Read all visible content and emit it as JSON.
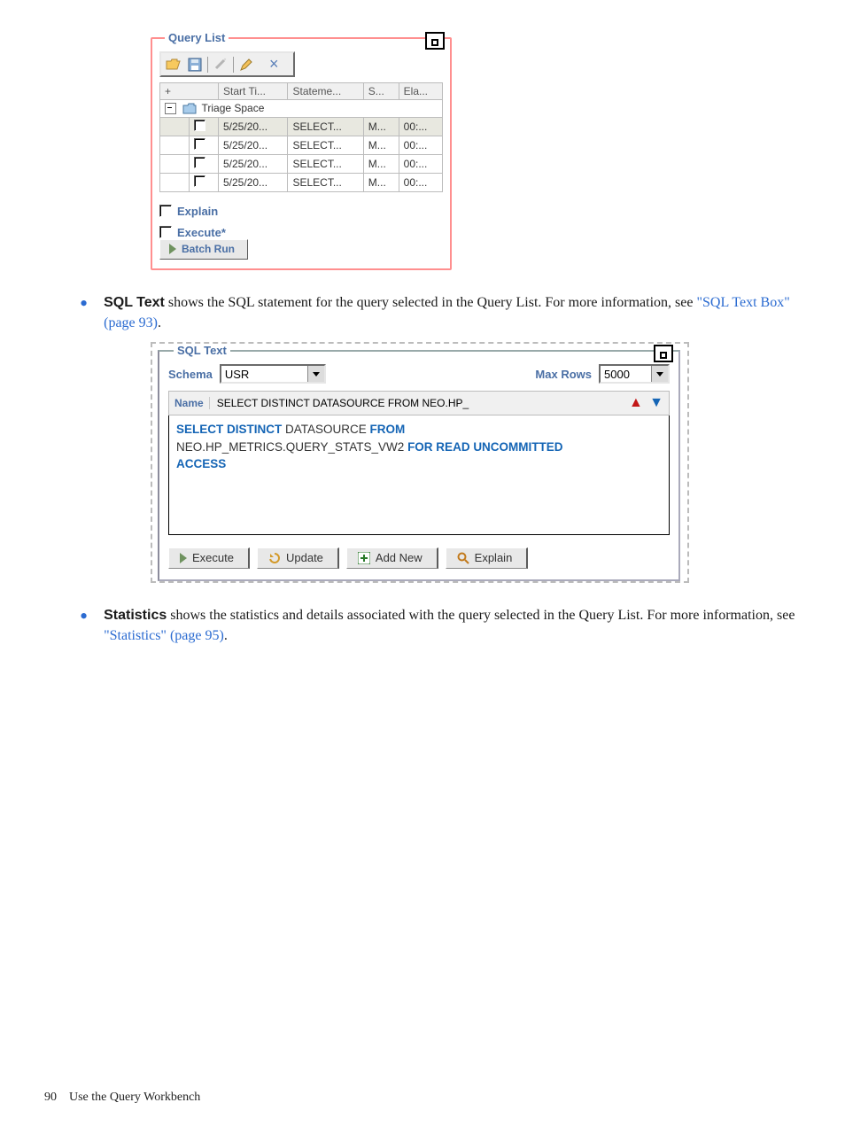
{
  "query_list": {
    "title": "Query List",
    "columns": {
      "c0": "+",
      "c1": "Start Ti...",
      "c2": "Stateme...",
      "c3": "S...",
      "c4": "Ela..."
    },
    "group_label": "Triage Space",
    "rows": [
      {
        "start": "5/25/20...",
        "stmt": "SELECT...",
        "s": "M...",
        "ela": "00:..."
      },
      {
        "start": "5/25/20...",
        "stmt": "SELECT...",
        "s": "M...",
        "ela": "00:..."
      },
      {
        "start": "5/25/20...",
        "stmt": "SELECT...",
        "s": "M...",
        "ela": "00:..."
      },
      {
        "start": "5/25/20...",
        "stmt": "SELECT...",
        "s": "M...",
        "ela": "00:..."
      }
    ],
    "buttons": {
      "explain": "Explain",
      "execute": "Execute*",
      "batch_run": "Batch Run"
    }
  },
  "para_sql_text": {
    "strong": "SQL Text",
    "body1": " shows the SQL statement for the query selected in the Query List. For more information, see ",
    "link": "\"SQL Text Box\" (page 93)",
    "tail": "."
  },
  "sql_text_panel": {
    "title": "SQL Text",
    "schema_label": "Schema",
    "schema_value": "USR",
    "maxrows_label": "Max Rows",
    "maxrows_value": "5000",
    "name_header": "Name",
    "name_value": "SELECT DISTINCT DATASOURCE FROM NEO.HP_",
    "body_tokens": {
      "l1a": "SELECT DISTINCT",
      "l1b": " DATASOURCE ",
      "l1c": "FROM",
      "l2a": "NEO.HP_METRICS.QUERY_STATS_VW2 ",
      "l2b": "FOR READ UNCOMMITTED",
      "l3": "ACCESS"
    },
    "buttons": {
      "execute": "Execute",
      "update": "Update",
      "addnew": "Add New",
      "explain": "Explain"
    }
  },
  "para_statistics": {
    "strong": "Statistics",
    "body1": " shows the statistics and details associated with the query selected in the Query List. For more information, see ",
    "link": "\"Statistics\" (page 95)",
    "tail": "."
  },
  "footer": {
    "pageno": "90",
    "title": "Use the Query Workbench"
  }
}
